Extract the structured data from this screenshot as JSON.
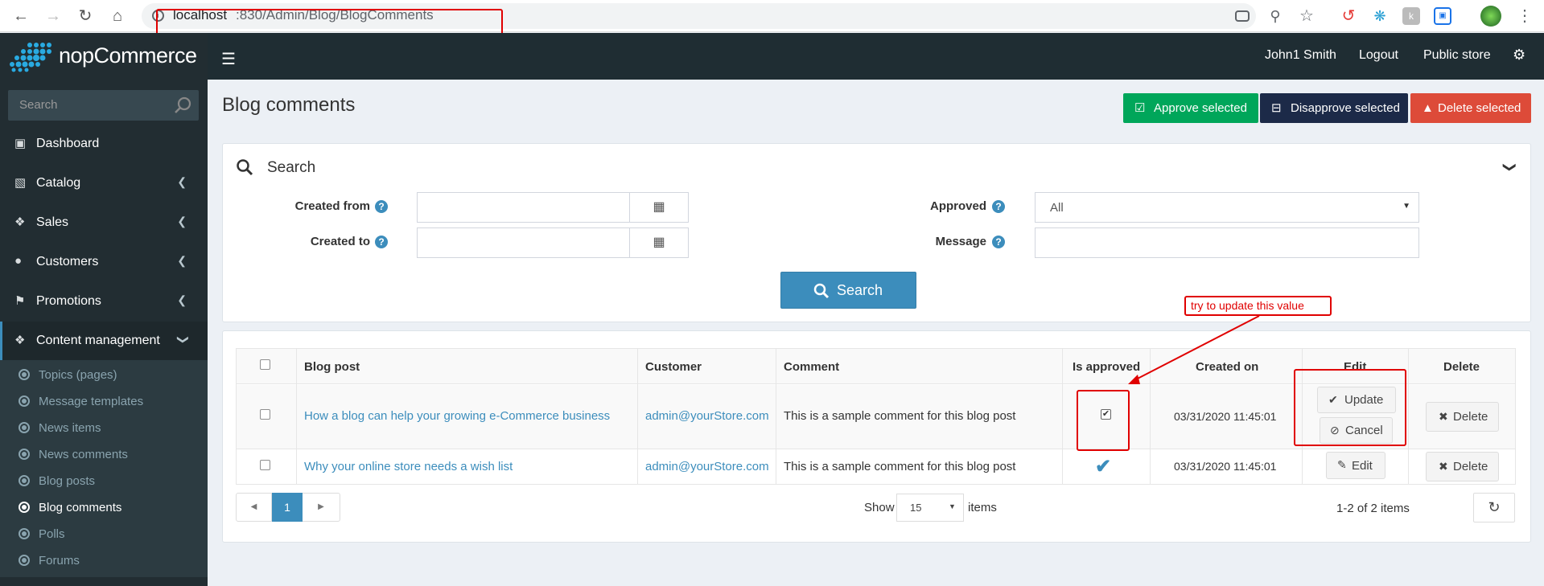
{
  "browser": {
    "url_host": "localhost",
    "url_path": ":830/Admin/Blog/BlogComments"
  },
  "header": {
    "logo_text": "nopCommerce",
    "user": "John1 Smith",
    "logout": "Logout",
    "public_store": "Public store"
  },
  "sidebar": {
    "search_placeholder": "Search",
    "items": [
      {
        "label": "Dashboard",
        "icon": "monitor-icon"
      },
      {
        "label": "Catalog",
        "icon": "book-icon"
      },
      {
        "label": "Sales",
        "icon": "cart-icon"
      },
      {
        "label": "Customers",
        "icon": "user-icon"
      },
      {
        "label": "Promotions",
        "icon": "tags-icon"
      },
      {
        "label": "Content management",
        "icon": "cubes-icon"
      }
    ],
    "subitems": [
      {
        "label": "Topics (pages)"
      },
      {
        "label": "Message templates"
      },
      {
        "label": "News items"
      },
      {
        "label": "News comments"
      },
      {
        "label": "Blog posts"
      },
      {
        "label": "Blog comments"
      },
      {
        "label": "Polls"
      },
      {
        "label": "Forums"
      }
    ]
  },
  "page": {
    "title": "Blog comments",
    "approve_selected": "Approve selected",
    "disapprove_selected": "Disapprove selected",
    "delete_selected": "Delete selected"
  },
  "search": {
    "heading": "Search",
    "created_from_label": "Created from",
    "created_to_label": "Created to",
    "approved_label": "Approved",
    "approved_value": "All",
    "message_label": "Message",
    "search_button": "Search"
  },
  "annotation": {
    "text": "try to update this value"
  },
  "table": {
    "headers": [
      "Blog post",
      "Customer",
      "Comment",
      "Is approved",
      "Created on",
      "Edit",
      "Delete"
    ],
    "rows": [
      {
        "blog_post": "How a blog can help your growing e-Commerce business",
        "customer": "admin@yourStore.com",
        "comment": "This is a sample comment for this blog post",
        "created_on": "03/31/2020 11:45:01",
        "update_label": "Update",
        "cancel_label": "Cancel",
        "delete_label": "Delete"
      },
      {
        "blog_post": "Why your online store needs a wish list",
        "customer": "admin@yourStore.com",
        "comment": "This is a sample comment for this blog post",
        "created_on": "03/31/2020 11:45:01",
        "edit_label": "Edit",
        "delete_label": "Delete"
      }
    ]
  },
  "pager": {
    "current_page": "1",
    "show_label": "Show",
    "page_size": "15",
    "items_label": "items",
    "summary": "1-2 of 2 items"
  },
  "colors": {
    "approve": "#00a65a",
    "disapprove": "#1c2a48",
    "delete": "#dd4b39",
    "primary": "#3c8dbc"
  }
}
